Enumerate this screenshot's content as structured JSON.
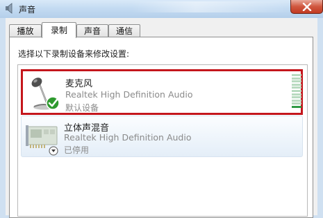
{
  "window": {
    "title": "声音",
    "close_icon": "close-icon"
  },
  "tabs": [
    {
      "label": "播放",
      "active": false
    },
    {
      "label": "录制",
      "active": true
    },
    {
      "label": "声音",
      "active": false
    },
    {
      "label": "通信",
      "active": false
    }
  ],
  "panel": {
    "prompt": "选择以下录制设备来修改设置:"
  },
  "devices": [
    {
      "name": "麦克风",
      "driver": "Realtek High Definition Audio",
      "status": "默认设备",
      "icon": "microphone-icon",
      "badge_icon": "default-checkmark-icon",
      "selected": true,
      "level": 0.05
    },
    {
      "name": "立体声混音",
      "driver": "Realtek High Definition Audio",
      "status": "已停用",
      "icon": "sound-card-icon",
      "badge_icon": "disabled-down-arrow-icon",
      "selected": false
    }
  ],
  "colors": {
    "selection_border": "#c4161c",
    "level_active": "#2f9a45",
    "level_inactive": "#b9dbc0",
    "check_green": "#2e9a2e"
  }
}
